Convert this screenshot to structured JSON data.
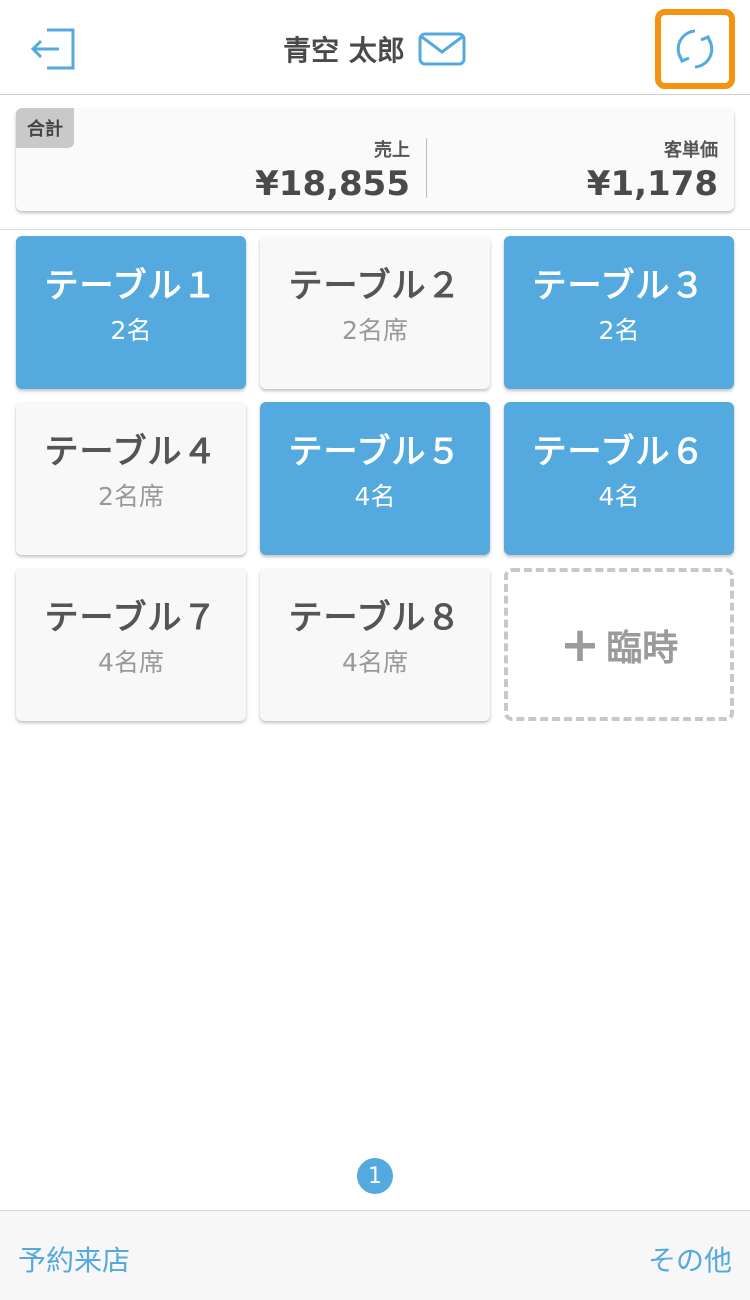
{
  "header": {
    "title": "青空 太郎",
    "icons": {
      "logout": "logout-icon",
      "mail": "mail-icon",
      "refresh": "refresh-icon"
    },
    "highlight_color": "#f5920f"
  },
  "summary": {
    "tag": "合計",
    "sales_label": "売上",
    "sales_value": "¥18,855",
    "avg_label": "客単価",
    "avg_value": "¥1,178"
  },
  "tables": [
    {
      "name": "テーブル１",
      "guests": "2名",
      "status": "occupied"
    },
    {
      "name": "テーブル２",
      "guests": "2名席",
      "status": "empty"
    },
    {
      "name": "テーブル３",
      "guests": "2名",
      "status": "occupied"
    },
    {
      "name": "テーブル４",
      "guests": "2名席",
      "status": "empty"
    },
    {
      "name": "テーブル５",
      "guests": "4名",
      "status": "occupied"
    },
    {
      "name": "テーブル６",
      "guests": "4名",
      "status": "occupied"
    },
    {
      "name": "テーブル７",
      "guests": "4名席",
      "status": "empty"
    },
    {
      "name": "テーブル８",
      "guests": "4名席",
      "status": "empty"
    }
  ],
  "add_tile": {
    "label": "臨時",
    "icon": "plus-icon"
  },
  "pager": {
    "current": "1"
  },
  "footer": {
    "left": "予約来店",
    "right": "その他"
  },
  "colors": {
    "accent": "#54a9df",
    "occupied": "#54a9df",
    "empty": "#f8f8f8"
  }
}
